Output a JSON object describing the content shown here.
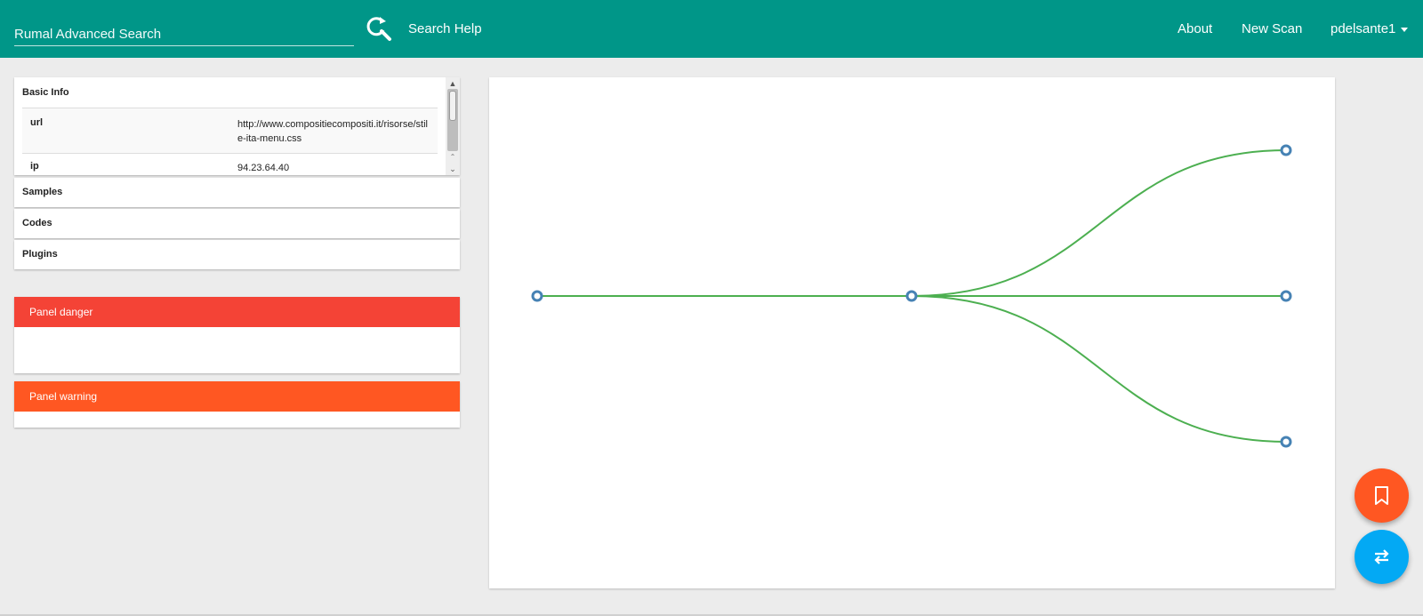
{
  "navbar": {
    "search_placeholder": "Rumal Advanced Search",
    "search_help": "Search Help",
    "about": "About",
    "new_scan": "New Scan",
    "user": "pdelsante1"
  },
  "basic_info": {
    "title": "Basic Info",
    "rows": [
      {
        "key": "url",
        "value": "http://www.compositiecompositi.it/risorse/stile-ita-menu.css"
      },
      {
        "key": "ip",
        "value": "94.23.64.40"
      }
    ]
  },
  "sections": {
    "samples": "Samples",
    "codes": "Codes",
    "plugins": "Plugins"
  },
  "alerts": {
    "danger": "Panel danger",
    "warning": "Panel warning"
  },
  "graph": {
    "node_count": 5,
    "edge_count": 4,
    "edge_color": "#4caf50",
    "node_color": "#4682b4"
  },
  "colors": {
    "navbar": "#009688",
    "danger": "#f44336",
    "warning": "#ff5722",
    "fab_bookmark": "#ff5722",
    "fab_swap": "#03a9f4"
  },
  "icons": {
    "search": "search-refresh-icon",
    "bookmark": "bookmark-icon",
    "swap": "swap-arrows-icon"
  }
}
